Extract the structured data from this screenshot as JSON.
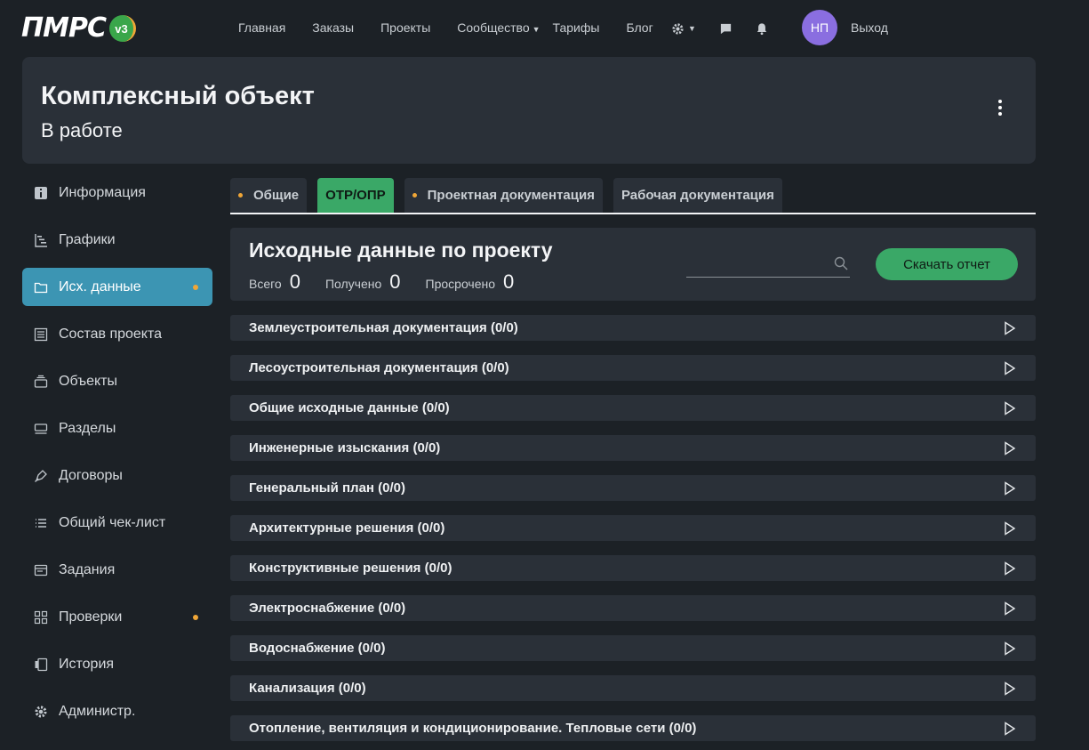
{
  "nav": {
    "logo_text": "ПМРС",
    "logo_version": "v3",
    "links": [
      "Главная",
      "Заказы",
      "Проекты",
      "Сообщество",
      "Тарифы",
      "Блог"
    ],
    "avatar_initials": "НП",
    "logout": "Выход"
  },
  "header": {
    "title": "Комплексный объект",
    "status": "В работе"
  },
  "sidebar": {
    "items": [
      {
        "label": "Информация",
        "icon": "info-icon"
      },
      {
        "label": "Графики",
        "icon": "gantt-icon"
      },
      {
        "label": "Исх. данные",
        "icon": "folder-icon",
        "active": true,
        "dot": true
      },
      {
        "label": "Состав проекта",
        "icon": "book-icon"
      },
      {
        "label": "Объекты",
        "icon": "layers-icon"
      },
      {
        "label": "Разделы",
        "icon": "sections-icon"
      },
      {
        "label": "Договоры",
        "icon": "pen-icon"
      },
      {
        "label": "Общий чек-лист",
        "icon": "checklist-icon"
      },
      {
        "label": "Задания",
        "icon": "tasks-icon"
      },
      {
        "label": "Проверки",
        "icon": "grid-icon",
        "dot": true
      },
      {
        "label": "История",
        "icon": "history-icon"
      },
      {
        "label": "Администр.",
        "icon": "gear-icon"
      }
    ]
  },
  "tabs": [
    {
      "label": "Общие",
      "dot": true
    },
    {
      "label": "ОТР/ОПР",
      "active": true
    },
    {
      "label": "Проектная документация",
      "dot": true
    },
    {
      "label": "Рабочая документация"
    }
  ],
  "panel": {
    "title": "Исходные данные по проекту",
    "stats": [
      {
        "label": "Всего",
        "value": "0"
      },
      {
        "label": "Получено",
        "value": "0"
      },
      {
        "label": "Просрочено",
        "value": "0"
      }
    ],
    "search_placeholder": "",
    "download_label": "Скачать отчет"
  },
  "sections": [
    "Землеустроительная документация (0/0)",
    "Лесоустроительная документация (0/0)",
    "Общие исходные данные (0/0)",
    "Инженерные изыскания (0/0)",
    "Генеральный план (0/0)",
    "Архитектурные решения (0/0)",
    "Конструктивные решения (0/0)",
    "Электроснабжение (0/0)",
    "Водоснабжение (0/0)",
    "Канализация (0/0)",
    "Отопление, вентиляция и кондиционирование. Тепловые сети (0/0)"
  ],
  "colors": {
    "background": "#1c2126",
    "card": "#2a3038",
    "accent_green": "#3aa867",
    "accent_blue": "#3c95b3",
    "dot_orange": "#f0a637",
    "avatar": "#8a6ee0"
  }
}
